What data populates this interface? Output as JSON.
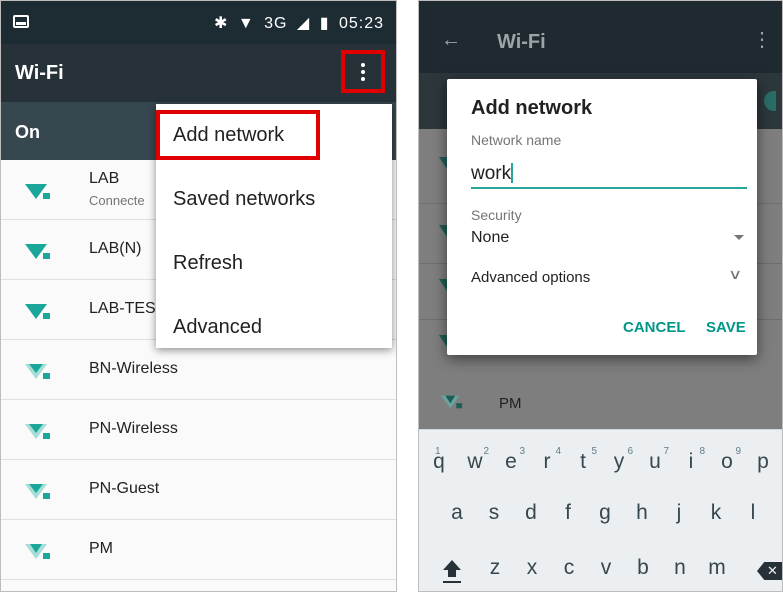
{
  "left": {
    "status": {
      "icons": [
        "bluetooth",
        "wifi",
        "3G",
        "signal",
        "battery"
      ],
      "network_type": "3G",
      "time": "05:23"
    },
    "appbar": {
      "title": "Wi-Fi"
    },
    "switch_label": "On",
    "networks": [
      {
        "name": "LAB",
        "status": "Connecte"
      },
      {
        "name": "LAB(N)"
      },
      {
        "name": "LAB-TES"
      },
      {
        "name": "BN-Wireless"
      },
      {
        "name": "PN-Wireless"
      },
      {
        "name": "PN-Guest"
      },
      {
        "name": "PM"
      }
    ],
    "menu": [
      "Add network",
      "Saved networks",
      "Refresh",
      "Advanced"
    ],
    "highlight_color": "#e10000"
  },
  "right": {
    "appbar": {
      "back_icon": "arrow-left-icon",
      "title": "Wi-Fi"
    },
    "dialog": {
      "title": "Add network",
      "network_name_label": "Network name",
      "network_name_value": "work",
      "security_label": "Security",
      "security_value": "None",
      "advanced_label": "Advanced options",
      "cancel": "CANCEL",
      "save": "SAVE"
    },
    "peek_network": "PM",
    "keyboard": {
      "row1": [
        [
          "q",
          ""
        ],
        [
          "w",
          "2"
        ],
        [
          "e",
          "3"
        ],
        [
          "r",
          "4"
        ],
        [
          "t",
          "5"
        ],
        [
          "y",
          "6"
        ],
        [
          "u",
          "7"
        ],
        [
          "i",
          "8"
        ],
        [
          "o",
          "9"
        ],
        [
          "p",
          ""
        ]
      ],
      "row1_first_hint": "1",
      "row2": [
        "a",
        "s",
        "d",
        "f",
        "g",
        "h",
        "j",
        "k",
        "l"
      ],
      "row3": [
        "z",
        "x",
        "c",
        "v",
        "b",
        "n",
        "m"
      ]
    },
    "accent": "#009688"
  }
}
